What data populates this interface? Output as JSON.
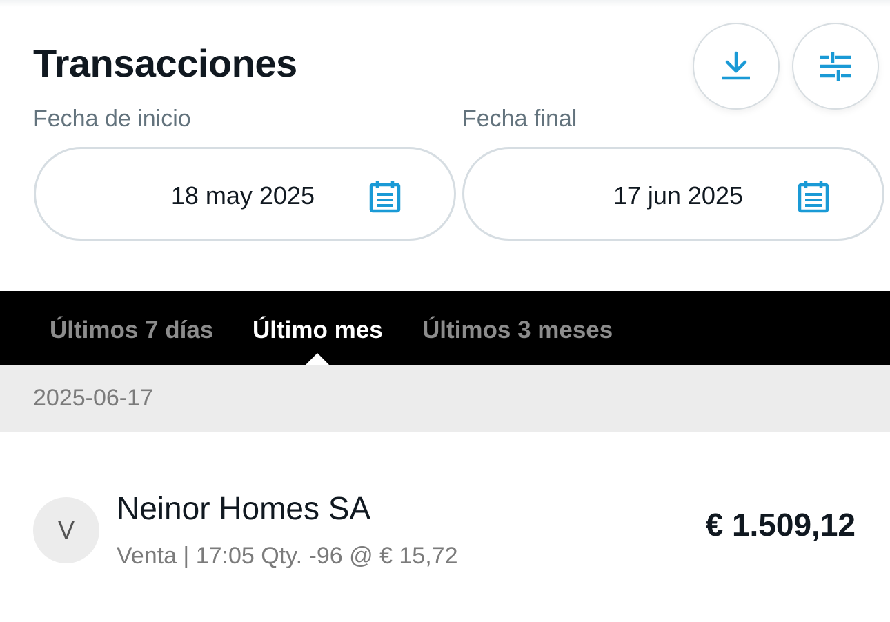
{
  "header": {
    "title": "Transacciones"
  },
  "actions": {
    "download_icon": "download-icon",
    "filter_icon": "sliders-icon"
  },
  "date_range": {
    "start_label": "Fecha de inicio",
    "start_value": "18 may 2025",
    "end_label": "Fecha final",
    "end_value": "17 jun 2025",
    "calendar_icon": "calendar-icon"
  },
  "tabs": [
    {
      "label": "Últimos 7 días",
      "active": false
    },
    {
      "label": "Último mes",
      "active": true
    },
    {
      "label": "Últimos 3 meses",
      "active": false
    }
  ],
  "groups": [
    {
      "date": "2025-06-17",
      "transactions": [
        {
          "avatar": "V",
          "name": "Neinor Homes SA",
          "detail": "Venta | 17:05 Qty. -96 @ € 15,72",
          "amount": "€ 1.509,12"
        }
      ]
    }
  ],
  "colors": {
    "accent": "#1a9ad6",
    "tabbar_bg": "#000000",
    "tab_active": "#ffffff",
    "tab_inactive": "#8c8c8c",
    "group_header_bg": "#ececec",
    "text_primary": "#101820",
    "text_secondary": "#63737d"
  }
}
